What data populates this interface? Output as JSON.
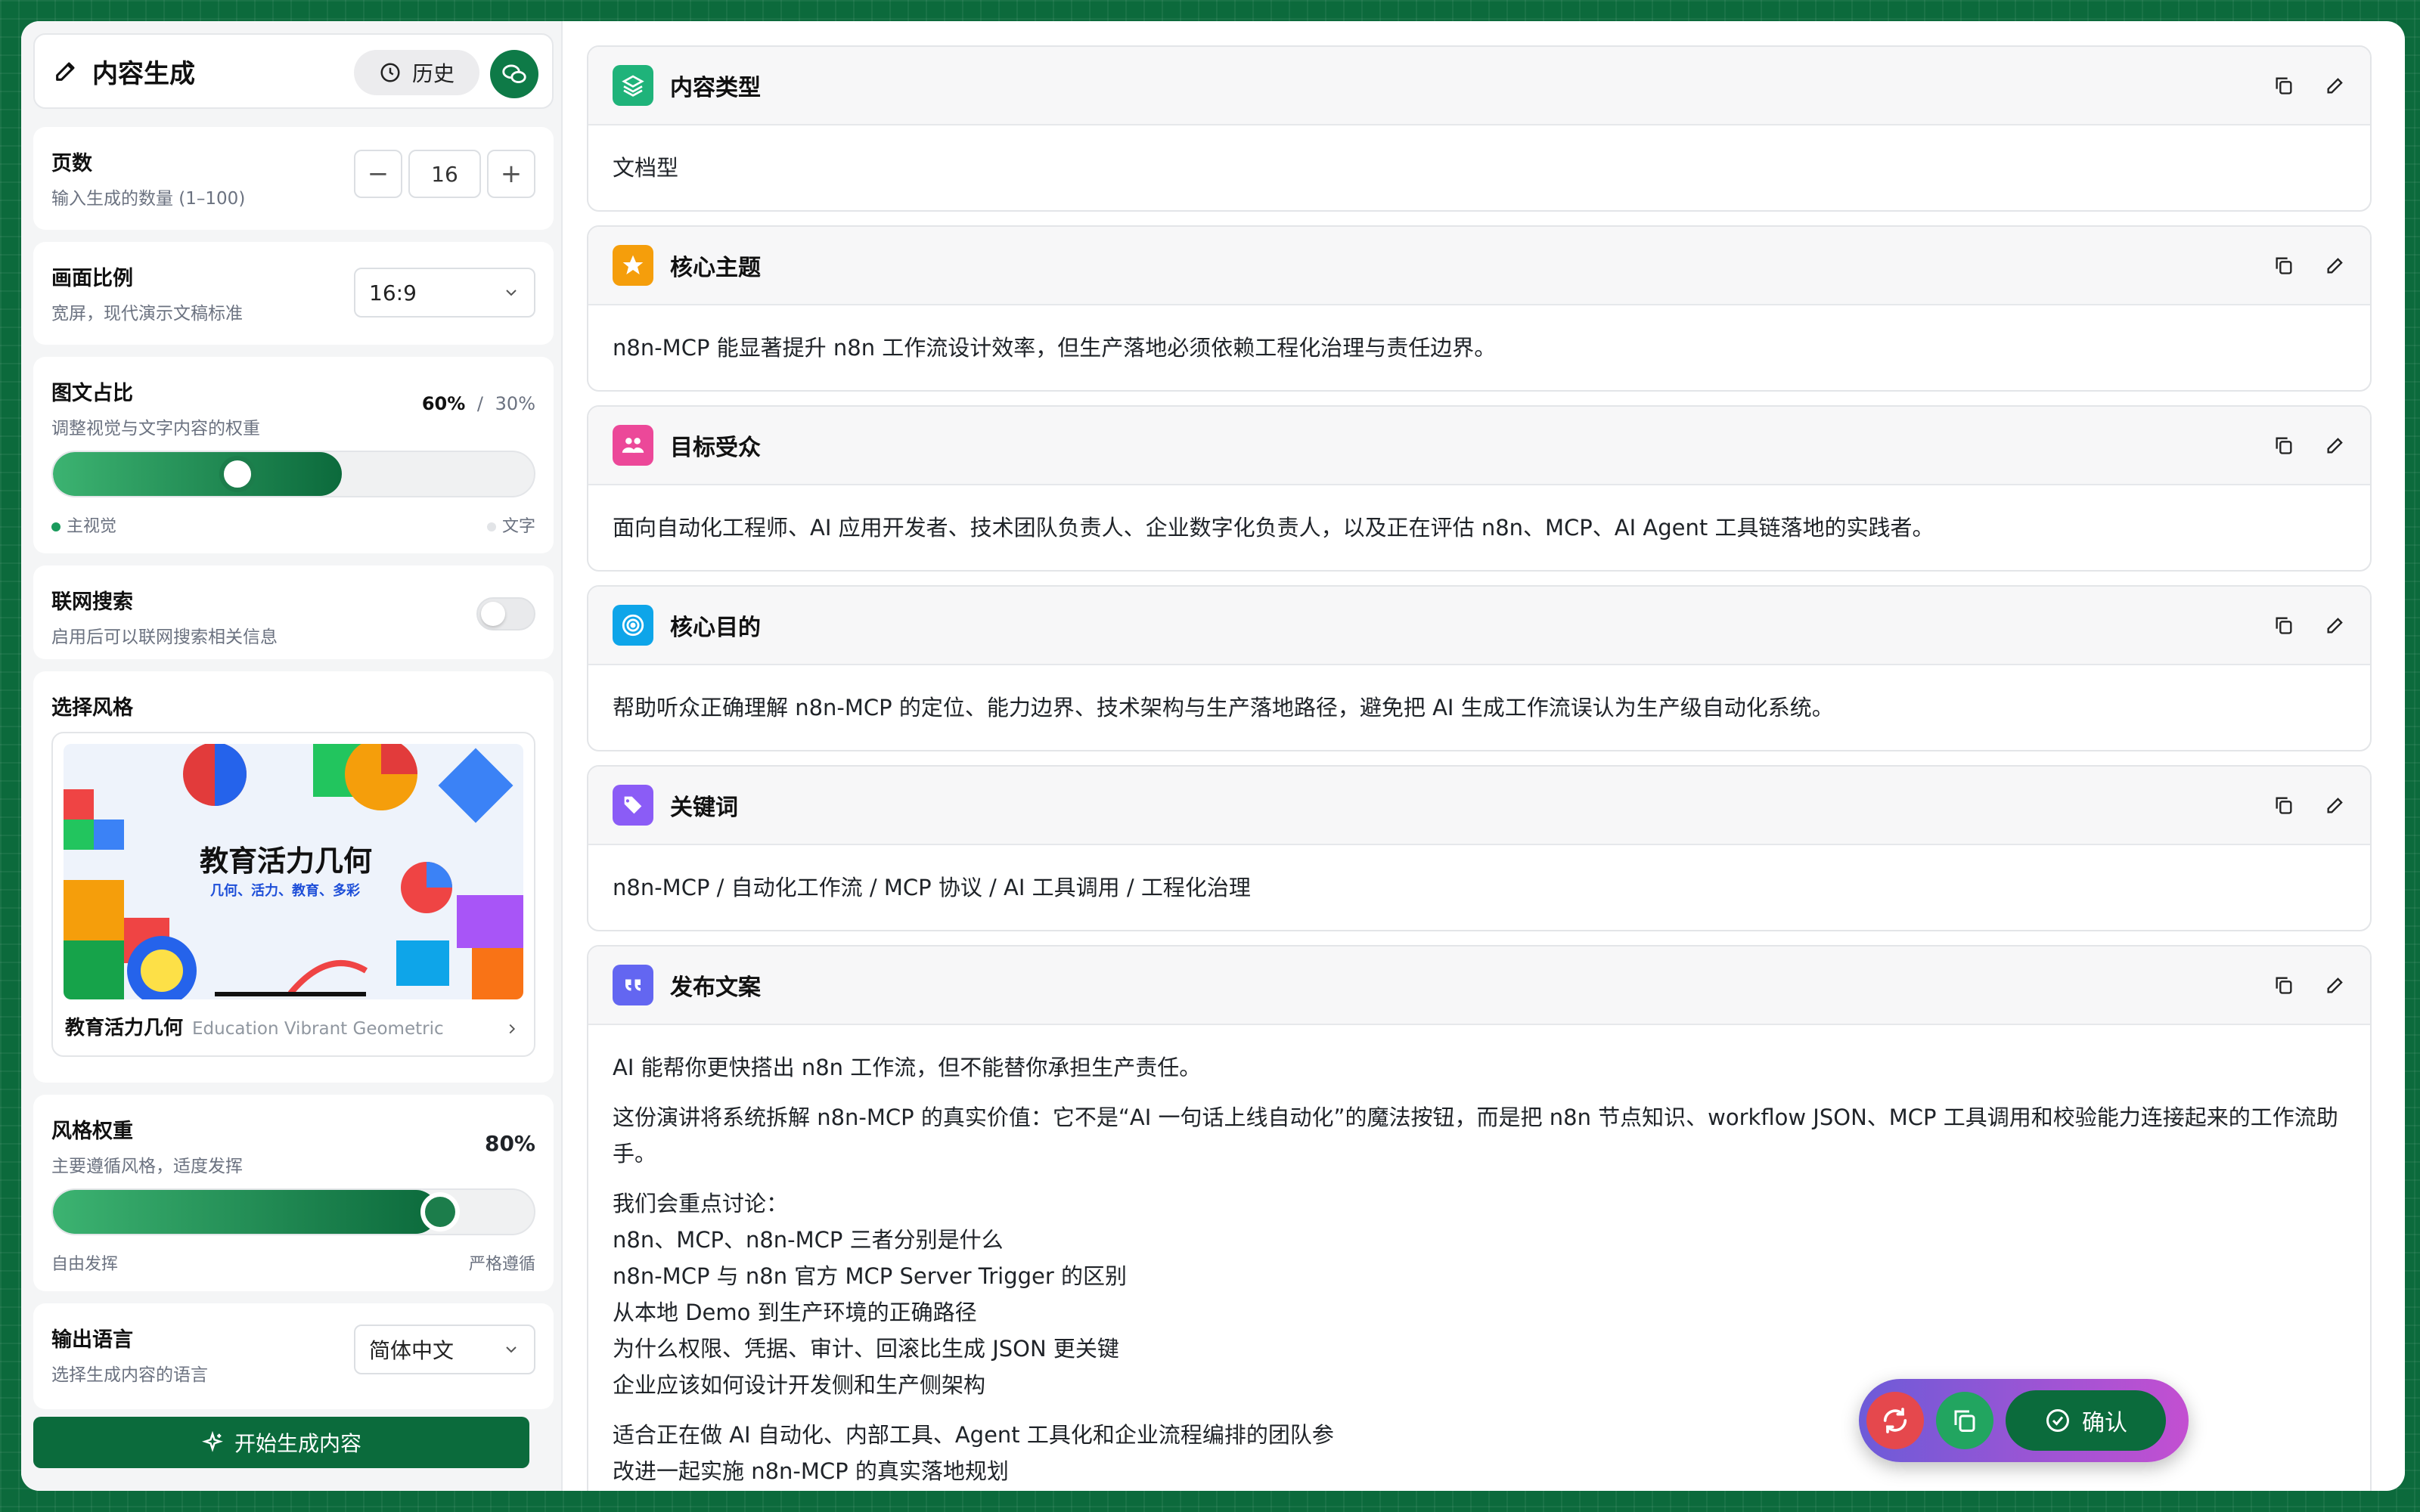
{
  "sidebar": {
    "title": "内容生成",
    "history_label": "历史",
    "pages": {
      "title": "页数",
      "subtitle": "输入生成的数量 (1–100)",
      "value": "16",
      "minus": "−",
      "plus": "+"
    },
    "aspect": {
      "title": "画面比例",
      "subtitle": "宽屏，现代演示文稿标准",
      "value": "16:9"
    },
    "ratio": {
      "title": "图文占比",
      "subtitle": "调整视觉与文字内容的权重",
      "visual_pct": "60%",
      "sep": "/",
      "text_pct": "30%",
      "visual_label": "主视觉",
      "text_label": "文字",
      "level": 0.6
    },
    "web_search": {
      "title": "联网搜索",
      "subtitle": "启用后可以联网搜索相关信息",
      "enabled": false
    },
    "style": {
      "title": "选择风格",
      "name": "教育活力几何",
      "name_en": "Education Vibrant Geometric",
      "thumb_title": "教育活力几何",
      "thumb_sub": "几何、活力、教育、多彩"
    },
    "weight": {
      "title": "风格权重",
      "subtitle": "主要遵循风格，适度发挥",
      "value": "80%",
      "left_label": "自由发挥",
      "right_label": "严格遵循",
      "level": 0.8
    },
    "language": {
      "title": "输出语言",
      "subtitle": "选择生成内容的语言",
      "value": "简体中文"
    },
    "generate_label": "开始生成内容"
  },
  "sections": [
    {
      "title": "内容类型",
      "icon": "layers-icon",
      "color": "#1fb37a",
      "body": [
        "文档型"
      ]
    },
    {
      "title": "核心主题",
      "icon": "star-icon",
      "color": "#f59e0b",
      "body": [
        "n8n-MCP 能显著提升 n8n 工作流设计效率，但生产落地必须依赖工程化治理与责任边界。"
      ]
    },
    {
      "title": "目标受众",
      "icon": "users-icon",
      "color": "#ec4899",
      "body": [
        "面向自动化工程师、AI 应用开发者、技术团队负责人、企业数字化负责人，以及正在评估 n8n、MCP、AI Agent 工具链落地的实践者。"
      ]
    },
    {
      "title": "核心目的",
      "icon": "target-icon",
      "color": "#0ea5e9",
      "body": [
        "帮助听众正确理解 n8n-MCP 的定位、能力边界、技术架构与生产落地路径，避免把 AI 生成工作流误认为生产级自动化系统。"
      ]
    },
    {
      "title": "关键词",
      "icon": "tags-icon",
      "color": "#8b5cf6",
      "body": [
        "n8n-MCP / 自动化工作流 / MCP 协议 / AI 工具调用 / 工程化治理"
      ]
    },
    {
      "title": "发布文案",
      "icon": "quote-icon",
      "color": "#6366f1",
      "body": [
        "AI 能帮你更快搭出 n8n 工作流，但不能替你承担生产责任。",
        "这份演讲将系统拆解 n8n-MCP 的真实价值：它不是“AI 一句话上线自动化”的魔法按钮，而是把 n8n 节点知识、workflow JSON、MCP 工具调用和校验能力连接起来的工作流助手。",
        "我们会重点讨论：",
        "n8n、MCP、n8n-MCP 三者分别是什么",
        "n8n-MCP 与 n8n 官方 MCP Server Trigger 的区别",
        "从本地 Demo 到生产环境的正确路径",
        "为什么权限、凭据、审计、回滚比生成 JSON 更关键",
        "企业应该如何设计开发侧和生产侧架构",
        "适合正在做 AI 自动化、内部工具、Agent 工具化和企业流程编排的团队参",
        "改进一起实施 n8n-MCP 的真实落地规划"
      ]
    }
  ],
  "float_bar": {
    "confirm_label": "确认"
  },
  "colors": {
    "brand": "#0b6b3c",
    "accent": "#3cb371"
  }
}
